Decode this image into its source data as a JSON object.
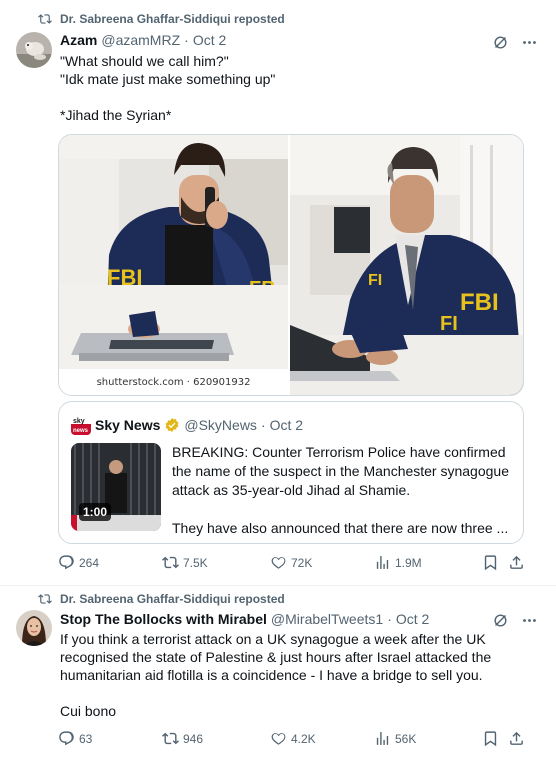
{
  "tweets": [
    {
      "repost_label": "Dr. Sabreena Ghaffar-Siddiqui reposted",
      "author_name": "Azam",
      "author_handle": "@azamMRZ",
      "separator": "·",
      "date": "Oct 2",
      "text_lines": [
        "\"What should we call him?\"",
        "\"Idk mate just make something up\"",
        "",
        "*Jihad the Syrian*"
      ],
      "media_caption": "shutterstock.com · 620901932",
      "quote": {
        "name": "Sky News",
        "handle": "@SkyNews",
        "separator": "·",
        "date": "Oct 2",
        "text_lines": [
          "BREAKING: Counter Terrorism Police have confirmed",
          "the name of the suspect in the Manchester synagogue",
          "attack as 35-year-old Jihad al Shamie.",
          "",
          "They have also announced that there are now three ..."
        ],
        "video_duration": "1:00"
      },
      "stats": {
        "replies": "264",
        "reposts": "7.5K",
        "likes": "72K",
        "views": "1.9M"
      }
    },
    {
      "repost_label": "Dr. Sabreena Ghaffar-Siddiqui reposted",
      "author_name": "Stop The Bollocks with Mirabel",
      "author_handle": "@MirabelTweets1",
      "separator": "·",
      "date": "Oct 2",
      "text_lines": [
        "If you think a terrorist attack on a UK synagogue a week after the UK",
        "recognised the state of Palestine & just hours after Israel attacked the",
        "humanitarian aid flotilla is a coincidence - I have a bridge to sell you.",
        "",
        "Cui bono"
      ],
      "stats": {
        "replies": "63",
        "reposts": "946",
        "likes": "4.2K",
        "views": "56K"
      }
    }
  ],
  "colors": {
    "secondary_text": "#536471",
    "primary_text": "#0f1419",
    "border": "#cfd9de",
    "verified_gold": "#e2b719",
    "sky_red": "#c8102e",
    "fbi_jacket": "#1d2b57",
    "fbi_letters": "#e8c21c"
  },
  "icons": [
    "repost-icon",
    "grok-icon",
    "more-icon",
    "reply-icon",
    "like-icon",
    "views-icon",
    "bookmark-icon",
    "share-icon",
    "verified-badge-icon"
  ]
}
